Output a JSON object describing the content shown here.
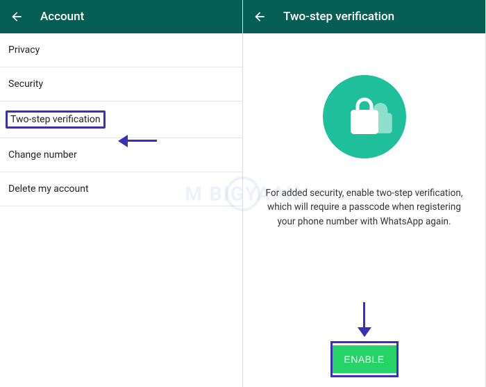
{
  "left": {
    "header_title": "Account",
    "items": {
      "privacy": "Privacy",
      "security": "Security",
      "twostep": "Two-step verification",
      "change_number": "Change number",
      "delete_account": "Delete my account"
    }
  },
  "right": {
    "header_title": "Two-step verification",
    "description": "For added security, enable two-step verification, which will require a passcode when registering your phone number with WhatsApp again.",
    "enable_label": "ENABLE"
  },
  "watermark": "M  BIGYAAN"
}
